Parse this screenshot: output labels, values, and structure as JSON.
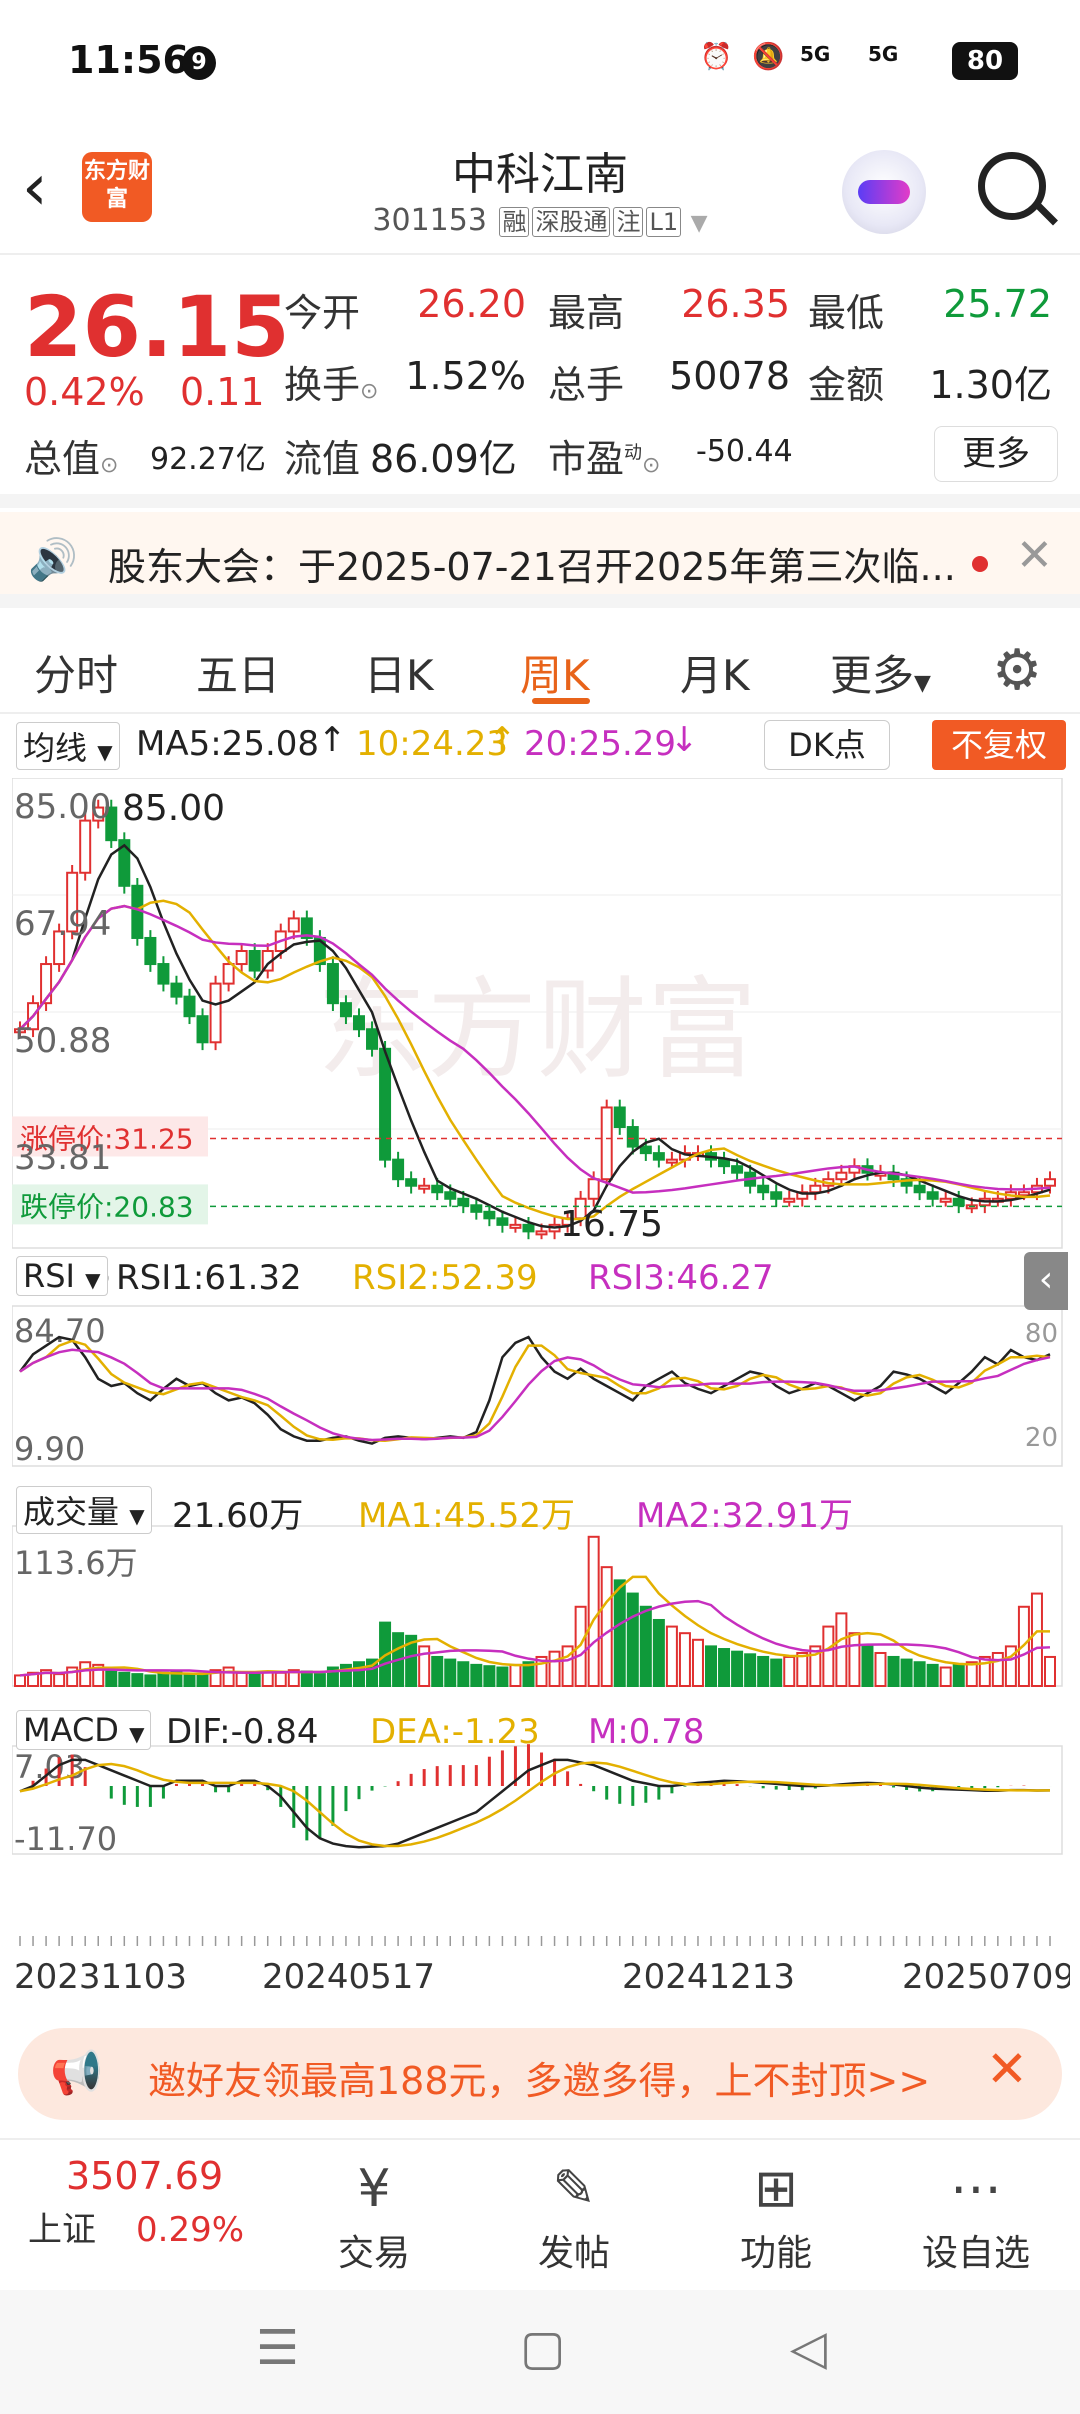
{
  "status_bar": {
    "time": "11:56",
    "notif_count": "9",
    "battery": "80",
    "signal1": "5G",
    "signal2": "5G"
  },
  "header": {
    "logo": "东方财富",
    "name": "中科江南",
    "code": "301153",
    "tags": [
      "融",
      "深股通",
      "注",
      "L1"
    ]
  },
  "quote": {
    "price": "26.15",
    "change_pct": "0.42%",
    "change": "0.11",
    "open_label": "今开",
    "open": "26.20",
    "high_label": "最高",
    "high": "26.35",
    "low_label": "最低",
    "low": "25.72",
    "turnover_label": "换手",
    "turnover": "1.52%",
    "volume_label": "总手",
    "volume": "50078",
    "amount_label": "金额",
    "amount": "1.30亿",
    "mcap_label": "总值",
    "mcap": "92.27亿",
    "float_label": "流值",
    "float": "86.09亿",
    "pe_label": "市盈",
    "pe_sup": "动",
    "pe": "-50.44",
    "more": "更多"
  },
  "notice": {
    "text": "股东大会：于2025-07-21召开2025年第三次临..."
  },
  "tabs": [
    "分时",
    "五日",
    "日K",
    "周K",
    "月K",
    "更多"
  ],
  "active_tab": "周K",
  "main_indicator": {
    "select": "均线",
    "ma5": "MA5:25.08",
    "ma10": "10:24.23",
    "ma20": "20:25.29",
    "dk": "DK点",
    "fq": "不复权"
  },
  "rsi_indicator": {
    "select": "RSI",
    "rsi1": "RSI1:61.32",
    "rsi2": "RSI2:52.39",
    "rsi3": "RSI3:46.27"
  },
  "vol_indicator": {
    "select": "成交量",
    "vol": "21.60万",
    "ma1": "MA1:45.52万",
    "ma2": "MA2:32.91万"
  },
  "macd_indicator": {
    "select": "MACD",
    "dif": "DIF:-0.84",
    "dea": "DEA:-1.23",
    "m": "M:0.78"
  },
  "chart_labels": {
    "y_ticks": [
      "85.00",
      "67.94",
      "50.88",
      "33.81",
      "16.75"
    ],
    "max_label": "85.00",
    "min_label": "16.75",
    "limit_up": "涨停价:31.25",
    "limit_down": "跌停价:20.83",
    "rsi_top": "84.70",
    "rsi_bottom": "9.90",
    "rsi_80": "80",
    "rsi_20": "20",
    "vol_top": "113.6万",
    "macd_top": "7.03",
    "macd_bottom": "-11.70",
    "dates": [
      "20231103",
      "20240517",
      "20241213",
      "20250709"
    ],
    "watermark": "东方财富"
  },
  "colors": {
    "up": "#e03030",
    "down": "#0f9a3a",
    "ma5": "#222222",
    "ma10": "#e3b000",
    "ma20": "#c62fbf",
    "accent": "#f15a24"
  },
  "invite": {
    "text": "邀好友领最高188元，多邀多得，上不封顶>>"
  },
  "bottom_bar": {
    "index_value": "3507.69",
    "index_name": "上证",
    "index_pct": "0.29%",
    "items": [
      "交易",
      "发帖",
      "功能",
      "设自选"
    ]
  }
}
